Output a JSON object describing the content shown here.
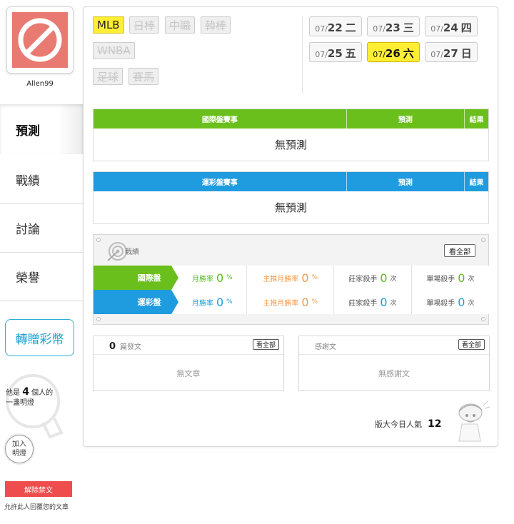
{
  "profile": {
    "username": "Allen99"
  },
  "nav": [
    {
      "label": "預測",
      "active": true
    },
    {
      "label": "戰績",
      "active": false
    },
    {
      "label": "討論",
      "active": false
    },
    {
      "label": "榮譽",
      "active": false
    }
  ],
  "transfer_label": "轉贈彩幣",
  "bulb": {
    "prefix": "他是",
    "count": "4",
    "suffix": "個人的",
    "line2": "一盞明燈",
    "join_l1": "加入",
    "join_l2": "明燈"
  },
  "ban": {
    "button": "解除禁文",
    "note": "允許此人回覆您的文章"
  },
  "sports": {
    "row1": [
      "MLB",
      "日棒",
      "中職",
      "韓棒"
    ],
    "row2": [
      "WNBA"
    ],
    "row3": [
      "足球",
      "賽馬"
    ]
  },
  "dates": [
    {
      "md": "07/",
      "dd": "22",
      "wd": "二",
      "active": false
    },
    {
      "md": "07/",
      "dd": "23",
      "wd": "三",
      "active": false
    },
    {
      "md": "07/",
      "dd": "24",
      "wd": "四",
      "active": false
    },
    {
      "md": "07/",
      "dd": "25",
      "wd": "五",
      "active": false
    },
    {
      "md": "07/",
      "dd": "26",
      "wd": "六",
      "active": true
    },
    {
      "md": "07/",
      "dd": "27",
      "wd": "日",
      "active": false
    }
  ],
  "intl_table": {
    "col1": "國際盤賽事",
    "col2": "預測",
    "col3": "結果",
    "empty": "無預測"
  },
  "lottery_table": {
    "col1": "運彩盤賽事",
    "col2": "預測",
    "col3": "結果",
    "empty": "無預測"
  },
  "record": {
    "title": "戰績",
    "view_all": "看全部",
    "rows": [
      {
        "label": "國際盤",
        "monthly_label": "月勝率",
        "monthly": "0",
        "pct": "%",
        "main_label": "主推月勝率",
        "main": "0",
        "banker_label": "莊家殺手",
        "banker": "0",
        "single_label": "單場殺手",
        "single": "0",
        "times": "次"
      },
      {
        "label": "運彩盤",
        "monthly_label": "月勝率",
        "monthly": "0",
        "pct": "%",
        "main_label": "主推月勝率",
        "main": "0",
        "banker_label": "莊家殺手",
        "banker": "0",
        "single_label": "單場殺手",
        "single": "0",
        "times": "次"
      }
    ]
  },
  "posts": {
    "count": "0",
    "title": "篇發文",
    "view_all": "看全部",
    "empty": "無文章"
  },
  "thanks": {
    "title": "感謝文",
    "view_all": "看全部",
    "empty": "無感謝文"
  },
  "popularity": {
    "label": "版大今日人氣",
    "value": "12"
  },
  "colors": {
    "green": "#6abf1c",
    "blue": "#1f9be0",
    "yellow": "#ffee33",
    "red": "#ef4d4d",
    "cyan": "#1aa3cf"
  }
}
